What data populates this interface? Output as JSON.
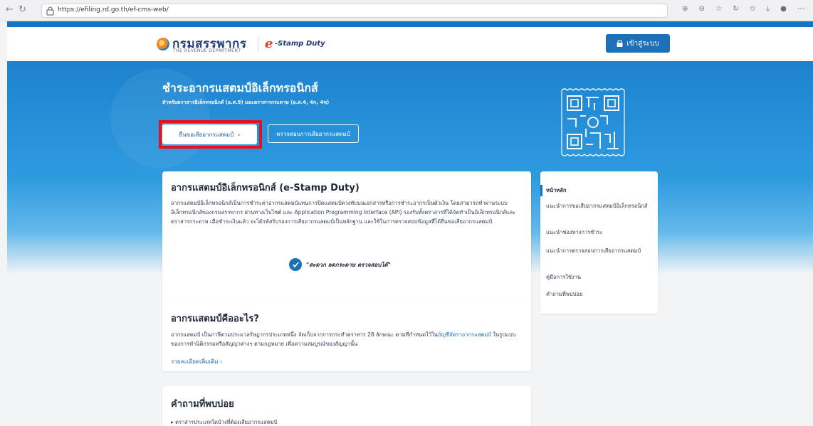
{
  "browser": {
    "url": "https://efiling.rd.go.th/ef-cms-web/",
    "icons": [
      "zoom-icon",
      "reader-icon",
      "bookmark-icon",
      "refresh-icon",
      "favorites-icon",
      "download-icon",
      "profile-icon",
      "more-icon"
    ]
  },
  "header": {
    "brand_name": "กรมสรรพากร",
    "brand_sub": "THE REVENUE DEPARTMENT",
    "estamp_e": "e",
    "estamp_label": "-Stamp Duty",
    "login_label": "เข้าสู่ระบบ"
  },
  "hero": {
    "title": "ชำระอากรแสตมป์อิเล็กทรอนิกส์",
    "subtitle": "สำหรับตราสารอิเล็กทรอนิกส์ (อ.ส.9) และตราสารกระดาษ (อ.ส.4, 4ก, 4ข)",
    "primary_button": "ยื่นขอเสียอากรแสตมป์",
    "primary_arrow": "›",
    "secondary_button": "ตรวจสอบการเสียอากรแสตมป์"
  },
  "card_intro": {
    "title": "อากรแสตมป์อิเล็กทรอนิกส์ (e-Stamp Duty)",
    "body": "อากรแสตมป์อิเล็กทรอนิกส์เป็นการชำระค่าอากรแสตมป์แทนการปิดแสตมป์ดวงทับบนเอกสารหรือการชำระอากรเป็นตัวเงิน โดยสามารถทำผ่านระบบอิเล็กทรอนิกส์ของกรมสรรพากร ผ่านทางเว็บไซต์ และ Application Programming Interface (API) รองรับทั้งตราสารที่ได้จัดทำเป็นอิเล็กทรอนิกส์และตราสารกระดาษ เมื่อชำระเงินแล้ว จะได้รหัสรับรองการเสียอากรแสตมป์เป็นหลักฐาน และใช้ในการตรวจสอบข้อมูลที่ได้ยื่นขอเสียอากรแสตมป์",
    "quote": "\"สะดวก ลดกระดาษ ตรวจสอบได้\""
  },
  "card_what": {
    "title": "อากรแสตมป์คืออะไร?",
    "body_before": "อากรแสตมป์ เป็นภาษีตามประมวลรัษฎากรประเภทหนึ่ง จัดเก็บจากการกระทำตราสาร 28 ลักษณะ ตามที่กำหนดไว้ใน",
    "body_link": "บัญชีอัตราอากรแสตมป์",
    "body_after": " ในรูปแบบของการทำนิติกรรมหรือสัญญาต่างๆ ตามกฎหมาย เพื่อความสมบูรณ์ของสัญญานั้น",
    "more_label": "รายละเอียดเพิ่มเติม",
    "more_arrow": "›"
  },
  "card_faq": {
    "title": "คำถามที่พบบ่อย",
    "first_item": "ตราสารประเภทใดบ้างที่ต้องเสียอากรแสตมป์"
  },
  "sidenav": {
    "items": [
      "หน้าหลัก",
      "แนะนำการขอเสียอากรแสตมป์อิเล็กทรอนิกส์",
      "แนะนำช่องทางการชำระ",
      "แนะนำการตรวจสอบการเสียอากรแสตมป์",
      "คู่มือการใช้งาน",
      "คำถามที่พบบ่อย"
    ]
  },
  "colors": {
    "accent": "#1c70b8",
    "highlight": "#e8101d",
    "hero": "#1d82cf"
  }
}
